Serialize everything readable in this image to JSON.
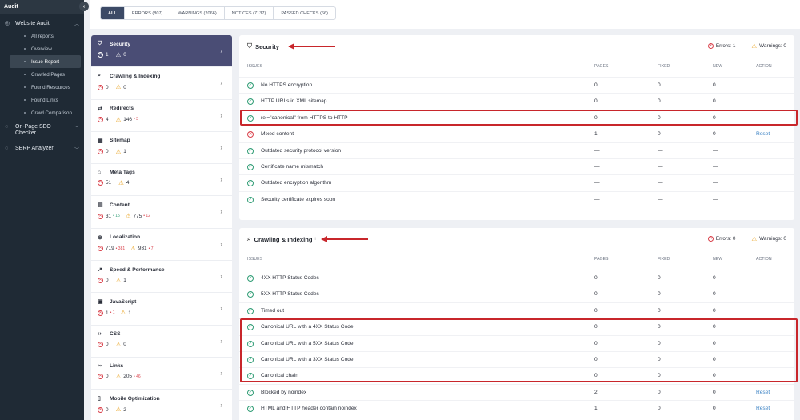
{
  "nav": {
    "title": "Audit",
    "website_audit": "Website Audit",
    "items": [
      "All reports",
      "Overview",
      "Issue Report",
      "Crawled Pages",
      "Found Resources",
      "Found Links",
      "Crawl Comparison"
    ],
    "onpage": "On-Page SEO Checker",
    "serp": "SERP Analyzer"
  },
  "tabs": [
    "ALL",
    "ERRORS (807)",
    "WARNINGS (2066)",
    "NOTICES (7137)",
    "PASSED CHECKS (66)"
  ],
  "categories": [
    {
      "name": "Security",
      "icon": "shield-icon",
      "errors": "1",
      "warnings": "0",
      "err_delta": "",
      "warn_delta": ""
    },
    {
      "name": "Crawling & Indexing",
      "icon": "search-icon",
      "errors": "0",
      "warnings": "0",
      "err_delta": "",
      "warn_delta": ""
    },
    {
      "name": "Redirects",
      "icon": "redirect-icon",
      "errors": "4",
      "warnings": "146",
      "err_delta": "",
      "warn_delta": "• 3"
    },
    {
      "name": "Sitemap",
      "icon": "sitemap-icon",
      "errors": "0",
      "warnings": "1",
      "err_delta": "",
      "warn_delta": ""
    },
    {
      "name": "Meta Tags",
      "icon": "tag-icon",
      "errors": "51",
      "warnings": "4",
      "err_delta": "",
      "warn_delta": ""
    },
    {
      "name": "Content",
      "icon": "content-icon",
      "errors": "31",
      "warnings": "775",
      "err_delta": "• 15",
      "warn_delta": "• 12"
    },
    {
      "name": "Localization",
      "icon": "globe-icon",
      "errors": "719",
      "warnings": "931",
      "err_delta": "• 381",
      "warn_delta": "• 7"
    },
    {
      "name": "Speed & Performance",
      "icon": "speed-icon",
      "errors": "0",
      "warnings": "1",
      "err_delta": "",
      "warn_delta": ""
    },
    {
      "name": "JavaScript",
      "icon": "js-icon",
      "errors": "1",
      "warnings": "1",
      "err_delta": "• 1",
      "warn_delta": ""
    },
    {
      "name": "CSS",
      "icon": "code-icon",
      "errors": "0",
      "warnings": "0",
      "err_delta": "",
      "warn_delta": ""
    },
    {
      "name": "Links",
      "icon": "link-icon",
      "errors": "0",
      "warnings": "205",
      "err_delta": "",
      "warn_delta": "• 46"
    },
    {
      "name": "Mobile Optimization",
      "icon": "mobile-icon",
      "errors": "0",
      "warnings": "2",
      "err_delta": "",
      "warn_delta": ""
    }
  ],
  "columns": {
    "issues": "ISSUES",
    "pages": "PAGES",
    "fixed": "FIXED",
    "new": "NEW",
    "action": "ACTION"
  },
  "security": {
    "title": "Security",
    "errors_label": "Errors: 1",
    "warnings_label": "Warnings: 0",
    "rows": [
      {
        "name": "No HTTPS encryption",
        "status": "ok",
        "pages": "0",
        "fixed": "0",
        "new": "0",
        "action": ""
      },
      {
        "name": "HTTP URLs in XML sitemap",
        "status": "ok",
        "pages": "0",
        "fixed": "0",
        "new": "0",
        "action": ""
      },
      {
        "name": "rel=\"canonical\" from HTTPS to HTTP",
        "status": "ok",
        "pages": "0",
        "fixed": "0",
        "new": "0",
        "action": ""
      },
      {
        "name": "Mixed content",
        "status": "bad",
        "pages": "1",
        "fixed": "0",
        "new": "0",
        "action": "Reset"
      },
      {
        "name": "Outdated security protocol version",
        "status": "ok",
        "pages": "—",
        "fixed": "—",
        "new": "—",
        "action": ""
      },
      {
        "name": "Certificate name mismatch",
        "status": "ok",
        "pages": "—",
        "fixed": "—",
        "new": "—",
        "action": ""
      },
      {
        "name": "Outdated encryption algorithm",
        "status": "ok",
        "pages": "—",
        "fixed": "—",
        "new": "—",
        "action": ""
      },
      {
        "name": "Security certificate expires soon",
        "status": "ok",
        "pages": "—",
        "fixed": "—",
        "new": "—",
        "action": ""
      }
    ]
  },
  "crawling": {
    "title": "Crawling & Indexing",
    "errors_label": "Errors: 0",
    "warnings_label": "Warnings: 0",
    "rows": [
      {
        "name": "4XX HTTP Status Codes",
        "status": "ok",
        "pages": "0",
        "fixed": "0",
        "new": "0",
        "action": ""
      },
      {
        "name": "5XX HTTP Status Codes",
        "status": "ok",
        "pages": "0",
        "fixed": "0",
        "new": "0",
        "action": ""
      },
      {
        "name": "Timed out",
        "status": "ok",
        "pages": "0",
        "fixed": "0",
        "new": "0",
        "action": ""
      },
      {
        "name": "Canonical URL with a 4XX Status Code",
        "status": "ok",
        "pages": "0",
        "fixed": "0",
        "new": "0",
        "action": ""
      },
      {
        "name": "Canonical URL with a 5XX Status Code",
        "status": "ok",
        "pages": "0",
        "fixed": "0",
        "new": "0",
        "action": ""
      },
      {
        "name": "Canonical URL with a 3XX Status Code",
        "status": "ok",
        "pages": "0",
        "fixed": "0",
        "new": "0",
        "action": ""
      },
      {
        "name": "Canonical chain",
        "status": "ok",
        "pages": "0",
        "fixed": "0",
        "new": "0",
        "action": ""
      },
      {
        "name": "Blocked by noindex",
        "status": "ok",
        "pages": "2",
        "fixed": "0",
        "new": "0",
        "action": "Reset"
      },
      {
        "name": "HTML and HTTP header contain noindex",
        "status": "ok",
        "pages": "1",
        "fixed": "0",
        "new": "0",
        "action": "Reset"
      }
    ]
  }
}
